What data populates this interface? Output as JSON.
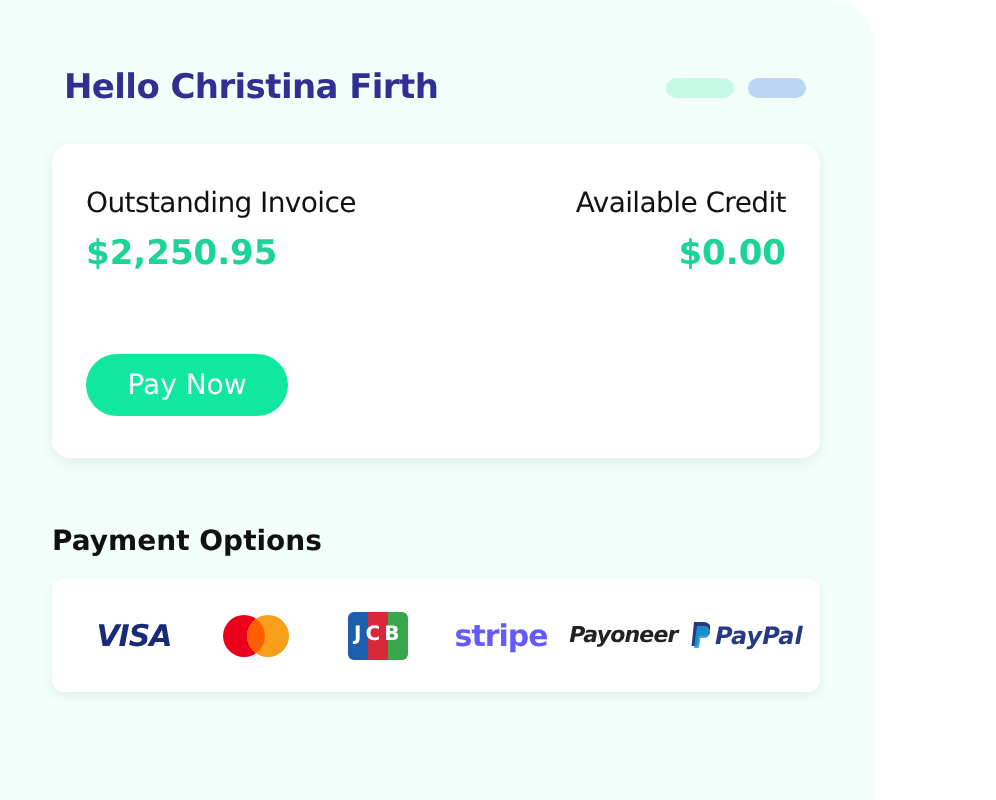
{
  "greeting": "Hello Christina Firth",
  "indicators": [
    {
      "color": "#c6f8e6"
    },
    {
      "color": "#bcd5f1"
    }
  ],
  "balance_card": {
    "items": [
      {
        "label": "Outstanding Invoice",
        "amount": "$2,250.95"
      },
      {
        "label": "Available Credit",
        "amount": "$0.00"
      }
    ],
    "button": "Pay Now"
  },
  "payment_options": {
    "title": "Payment Options",
    "logos": [
      {
        "kind": "visa",
        "text": "VISA"
      },
      {
        "kind": "mastercard"
      },
      {
        "kind": "jcb",
        "text": "JCB"
      },
      {
        "kind": "stripe",
        "text": "stripe"
      },
      {
        "kind": "payoneer",
        "text": "Payoneer"
      },
      {
        "kind": "paypal",
        "text": "PayPal"
      }
    ]
  }
}
